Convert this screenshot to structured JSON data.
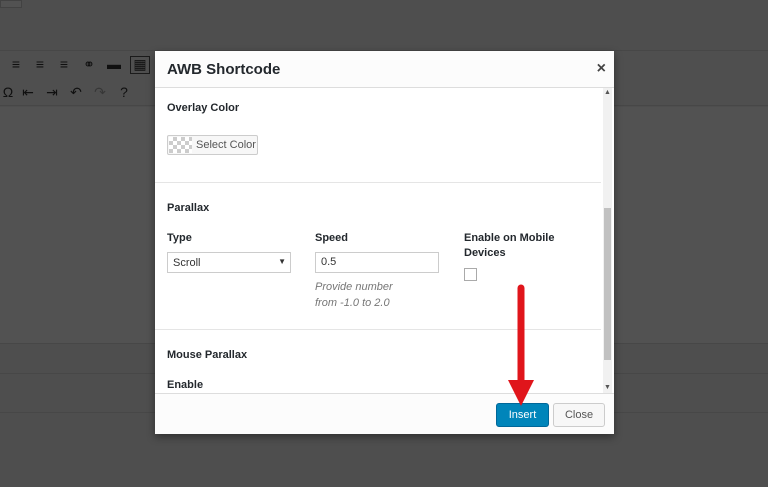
{
  "modal": {
    "title": "AWB Shortcode",
    "close_glyph": "×"
  },
  "overlay_color": {
    "section_title": "Overlay Color",
    "button_label": "Select Color"
  },
  "parallax": {
    "section_title": "Parallax",
    "type_label": "Type",
    "type_value": "Scroll",
    "speed_label": "Speed",
    "speed_value": "0.5",
    "speed_hint_line1": "Provide number",
    "speed_hint_line2": "from -1.0 to 2.0",
    "mobile_label_line1": "Enable on Mobile",
    "mobile_label_line2": "Devices",
    "mobile_checked": false
  },
  "mouse_parallax": {
    "section_title": "Mouse Parallax",
    "enable_label": "Enable"
  },
  "footer": {
    "insert_label": "Insert",
    "close_label": "Close"
  },
  "colors": {
    "primary": "#0085ba",
    "arrow": "#e0151b"
  }
}
